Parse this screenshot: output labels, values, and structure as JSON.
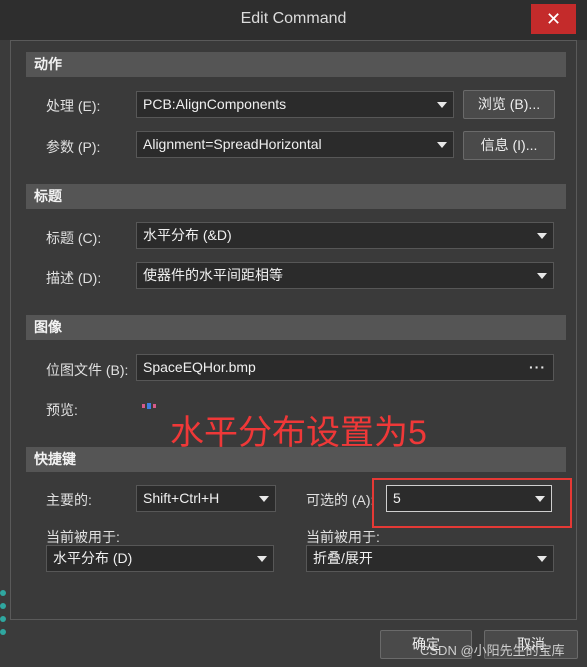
{
  "window": {
    "title": "Edit Command",
    "close_symbol": "✕"
  },
  "sections": {
    "action": "动作",
    "title": "标题",
    "image": "图像",
    "shortcut": "快捷键"
  },
  "action": {
    "process_label": "处理 (E):",
    "process_value": "PCB:AlignComponents",
    "browse_button": "浏览 (B)...",
    "params_label": "参数 (P):",
    "params_value": "Alignment=SpreadHorizontal",
    "info_button": "信息 (I)..."
  },
  "titleSection": {
    "caption_label": "标题 (C):",
    "caption_value": "水平分布 (&D)",
    "desc_label": "描述 (D):",
    "desc_value": "使器件的水平间距相等"
  },
  "imageSection": {
    "bitmap_label": "位图文件 (B):",
    "bitmap_value": "SpaceEQHor.bmp",
    "bitmap_more": "···",
    "preview_label": "预览:"
  },
  "shortcut": {
    "primary_label": "主要的:",
    "primary_value": "Shift+Ctrl+H",
    "optional_label": "可选的 (A):",
    "optional_value": "5",
    "used_by_label_left": "当前被用于:",
    "used_by_value_left": "水平分布 (D)",
    "used_by_label_right": "当前被用于:",
    "used_by_value_right": "折叠/展开"
  },
  "footer": {
    "ok_button": "确定",
    "cancel_button": "取消"
  },
  "annotation": {
    "text": "水平分布设置为5",
    "color": "#ef3838"
  },
  "watermark": "CSDN @小阳先生的宝库",
  "colors": {
    "close": "#c42b2b",
    "highlight": "#e53935"
  },
  "icons": {
    "close": "close-icon",
    "dropdown": "chevron-down-icon",
    "preview": "align-preview-icon"
  }
}
